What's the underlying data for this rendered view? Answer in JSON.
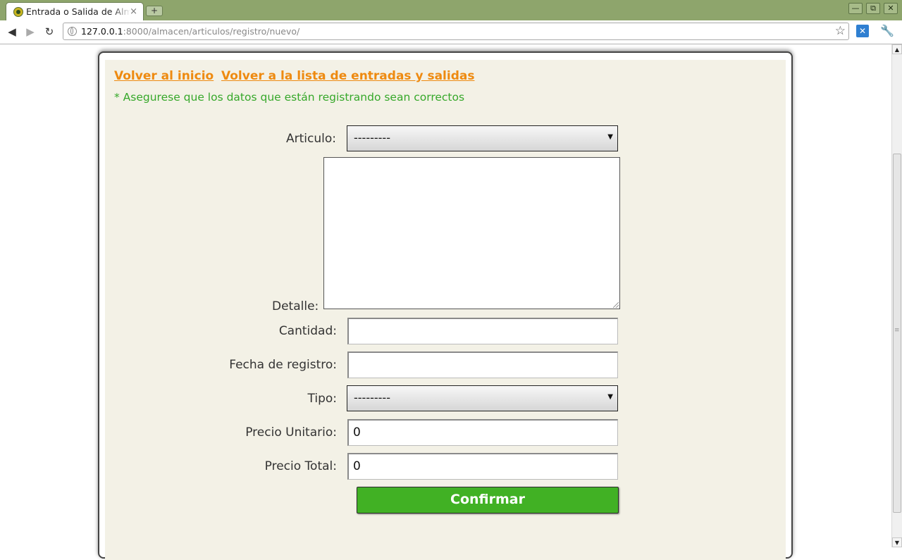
{
  "browser": {
    "tab_title": "Entrada o Salida de Almacen",
    "tab_close": "×",
    "new_tab": "+",
    "url_host": "127.0.0.1",
    "url_rest": ":8000/almacen/articulos/registro/nuevo/",
    "window_buttons": {
      "minimize": "—",
      "restore": "⧉",
      "close": "✕"
    },
    "nav": {
      "back": "◀",
      "forward": "▶",
      "reload": "↻"
    },
    "bookmark_star": "☆",
    "extension_icon": "✕",
    "wrench": "🔧"
  },
  "page": {
    "links": {
      "home": "Volver al inicio",
      "list": "Volver a la lista de entradas y salidas"
    },
    "notice": "* Asegurese que los datos que están registrando sean correctos",
    "form": {
      "articulo_label": "Articulo:",
      "articulo_value": "---------",
      "detalle_label": "Detalle:",
      "detalle_value": "",
      "cantidad_label": "Cantidad:",
      "cantidad_value": "",
      "fecha_label": "Fecha de registro:",
      "fecha_value": "",
      "tipo_label": "Tipo:",
      "tipo_value": "---------",
      "precio_unitario_label": "Precio Unitario:",
      "precio_unitario_value": "0",
      "precio_total_label": "Precio Total:",
      "precio_total_value": "0",
      "submit_label": "Confirmar"
    }
  },
  "colors": {
    "chrome_frame": "#8ea56c",
    "link_orange": "#ee8a10",
    "notice_green": "#36a82a",
    "panel_bg": "#f3f1e6",
    "button_green": "#41b124"
  },
  "icons": [
    "favicon-icon",
    "globe-icon",
    "star-icon",
    "extension-icon",
    "wrench-icon",
    "dropdown-arrow-icon",
    "resize-grip-icon"
  ]
}
